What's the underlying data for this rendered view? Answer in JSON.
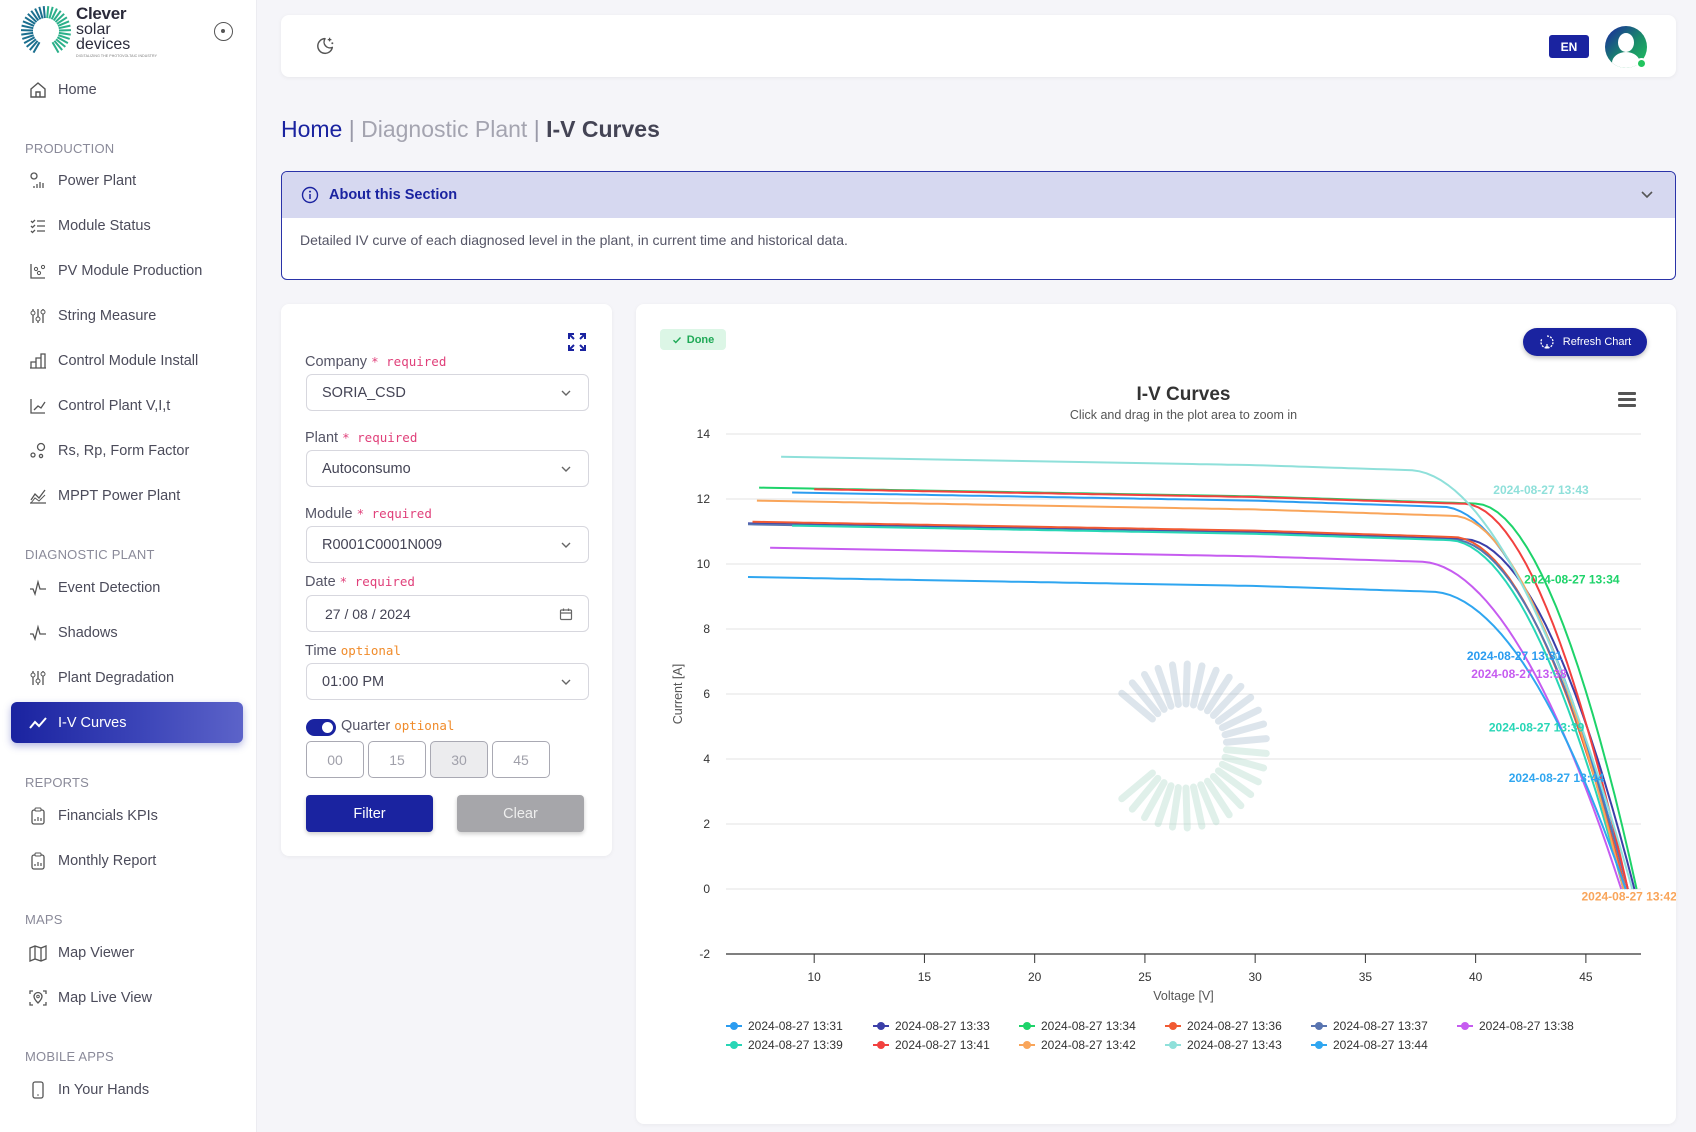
{
  "brand": {
    "line1": "Clever",
    "line2": "solar",
    "line3": "devices",
    "tagline": "DIGITALIZING THE PHOTOVOLTAIC INDUSTRY"
  },
  "topbar": {
    "language": "EN"
  },
  "sidebar": {
    "home": "Home",
    "sections": [
      {
        "title": "PRODUCTION",
        "items": [
          "Power Plant",
          "Module Status",
          "PV Module Production",
          "String Measure",
          "Control Module Install",
          "Control Plant V,I,t",
          "Rs, Rp, Form Factor",
          "MPPT Power Plant"
        ]
      },
      {
        "title": "DIAGNOSTIC PLANT",
        "items": [
          "Event Detection",
          "Shadows",
          "Plant Degradation",
          "I-V Curves"
        ]
      },
      {
        "title": "REPORTS",
        "items": [
          "Financials KPIs",
          "Monthly Report"
        ]
      },
      {
        "title": "MAPS",
        "items": [
          "Map Viewer",
          "Map Live View"
        ]
      },
      {
        "title": "MOBILE APPS",
        "items": [
          "In Your Hands"
        ]
      }
    ],
    "active": "I-V Curves"
  },
  "breadcrumb": {
    "home": "Home",
    "sep": "|",
    "section": "Diagnostic Plant",
    "current": "I-V Curves"
  },
  "about": {
    "title": "About this Section",
    "text": "Detailed IV curve of each diagnosed level in the plant, in current time and historical data."
  },
  "filters": {
    "company": {
      "label": "Company",
      "flag": "* required",
      "value": "SORIA_CSD"
    },
    "plant": {
      "label": "Plant",
      "flag": "* required",
      "value": "Autoconsumo"
    },
    "module": {
      "label": "Module",
      "flag": "* required",
      "value": "R0001C0001N009"
    },
    "date": {
      "label": "Date",
      "flag": "* required",
      "value": "27 / 08 / 2024"
    },
    "time": {
      "label": "Time",
      "flag": "optional",
      "value": "01:00 PM"
    },
    "quarter": {
      "label": "Quarter",
      "flag": "optional",
      "enabled": true,
      "options": [
        "00",
        "15",
        "30",
        "45"
      ],
      "selected": "30"
    },
    "filter_label": "Filter",
    "clear_label": "Clear"
  },
  "chart_panel": {
    "status": "Done",
    "refresh_label": "Refresh Chart"
  },
  "chart_data": {
    "type": "line",
    "title": "I-V Curves",
    "subtitle": "Click and drag in the plot area to zoom in",
    "xlabel": "Voltage [V]",
    "ylabel": "Current [A]",
    "xlim": [
      6,
      47.5
    ],
    "ylim": [
      -2,
      14
    ],
    "xticks": [
      10,
      15,
      20,
      25,
      30,
      35,
      40,
      45
    ],
    "yticks": [
      -2,
      0,
      2,
      4,
      6,
      8,
      10,
      12,
      14
    ],
    "grid": true,
    "legend": "bottom",
    "series": [
      {
        "name": "2024-08-27 13:31",
        "color": "#2b9cf0",
        "isc": 12.2,
        "vstart": 9,
        "voc": 46.9,
        "knee": 38.5,
        "label": true
      },
      {
        "name": "2024-08-27 13:33",
        "color": "#3b3fa8",
        "isc": 11.25,
        "vstart": 7,
        "voc": 47.2,
        "knee": 39.5,
        "label": false
      },
      {
        "name": "2024-08-27 13:34",
        "color": "#1ed36a",
        "isc": 12.35,
        "vstart": 7.5,
        "voc": 47.3,
        "knee": 40,
        "label": true
      },
      {
        "name": "2024-08-27 13:36",
        "color": "#f15a33",
        "isc": 11.3,
        "vstart": 7.2,
        "voc": 46.8,
        "knee": 39,
        "label": false
      },
      {
        "name": "2024-08-27 13:37",
        "color": "#5874b0",
        "isc": 11.22,
        "vstart": 7,
        "voc": 46.9,
        "knee": 39,
        "label": false
      },
      {
        "name": "2024-08-27 13:38",
        "color": "#c65cf0",
        "isc": 10.5,
        "vstart": 8,
        "voc": 46.6,
        "knee": 37.5,
        "label": true
      },
      {
        "name": "2024-08-27 13:39",
        "color": "#28d6b6",
        "isc": 11.18,
        "vstart": 9,
        "voc": 46.7,
        "knee": 38.8,
        "label": true
      },
      {
        "name": "2024-08-27 13:41",
        "color": "#f2413f",
        "isc": 12.3,
        "vstart": 10,
        "voc": 46.9,
        "knee": 39.5,
        "label": false
      },
      {
        "name": "2024-08-27 13:42",
        "color": "#f9a55a",
        "isc": 11.95,
        "vstart": 7.4,
        "voc": 46.7,
        "knee": 39,
        "label": true
      },
      {
        "name": "2024-08-27 13:43",
        "color": "#8fe0da",
        "isc": 13.3,
        "vstart": 8.5,
        "voc": 47.1,
        "knee": 37,
        "label": true
      },
      {
        "name": "2024-08-27 13:44",
        "color": "#2fa6f0",
        "isc": 9.6,
        "vstart": 7,
        "voc": 46.8,
        "knee": 38,
        "label": true
      }
    ],
    "annotations": [
      {
        "text": "2024-08-27 13:43",
        "series": 9,
        "x": 40.8,
        "y": 12.15
      },
      {
        "text": "2024-08-27 13:34",
        "series": 2,
        "x": 42.2,
        "y": 9.4
      },
      {
        "text": "2024-08-27 13:31",
        "series": 0,
        "x": 39.6,
        "y": 7.05
      },
      {
        "text": "2024-08-27 13:38",
        "series": 5,
        "x": 39.8,
        "y": 6.5
      },
      {
        "text": "2024-08-27 13:39",
        "series": 6,
        "x": 40.6,
        "y": 4.85
      },
      {
        "text": "2024-08-27 13:44",
        "series": 10,
        "x": 41.5,
        "y": 3.3
      },
      {
        "text": "2024-08-27 13:42",
        "series": 8,
        "x": 44.8,
        "y": -0.35
      }
    ]
  }
}
